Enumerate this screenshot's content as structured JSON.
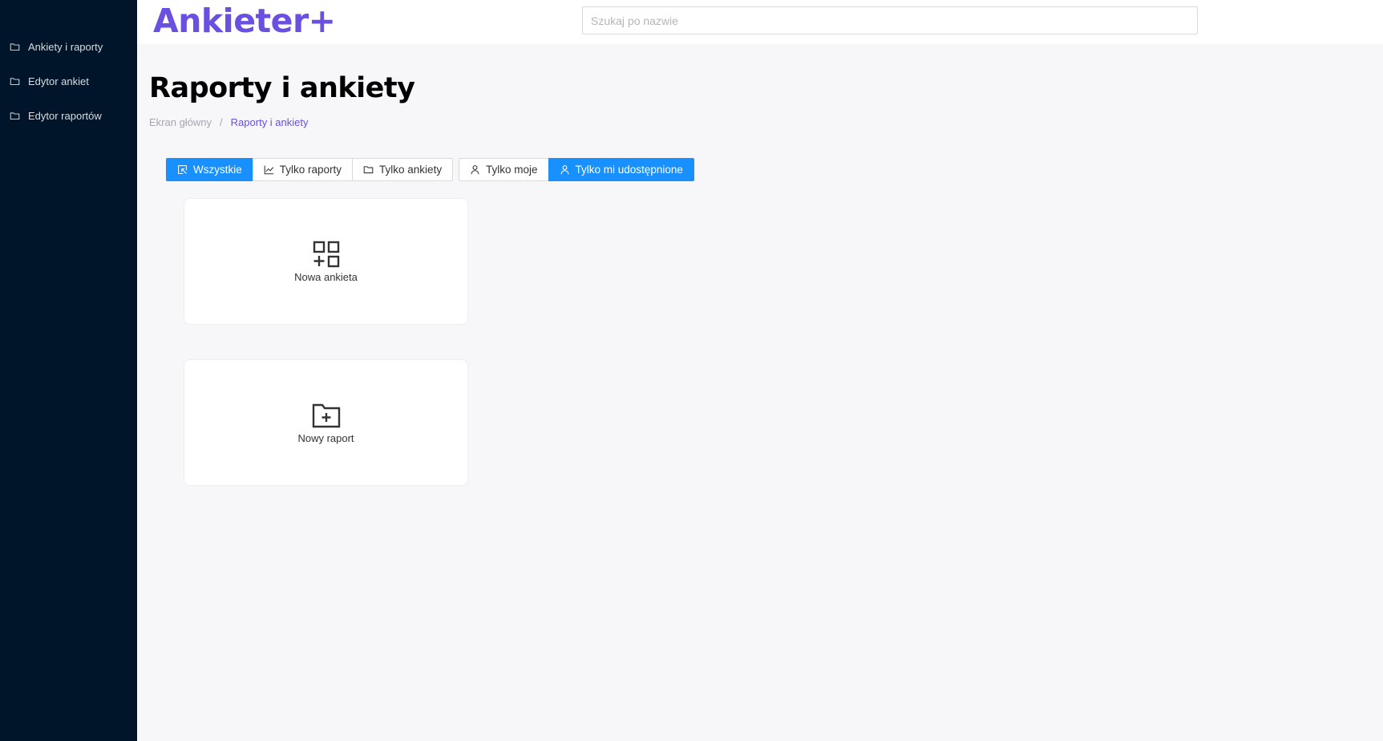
{
  "app": {
    "logo": "Ankieter+"
  },
  "sidebar": {
    "items": [
      {
        "label": "Ankiety i raporty",
        "icon": "folder-icon"
      },
      {
        "label": "Edytor ankiet",
        "icon": "folder-icon"
      },
      {
        "label": "Edytor raportów",
        "icon": "folder-icon"
      }
    ]
  },
  "search": {
    "placeholder": "Szukaj po nazwie",
    "value": ""
  },
  "page": {
    "title": "Raporty i ankiety"
  },
  "breadcrumb": {
    "home": "Ekran główny",
    "separator": "/",
    "current": "Raporty i ankiety"
  },
  "filters": {
    "type": [
      {
        "label": "Wszystkie",
        "icon": "select-icon",
        "active": true
      },
      {
        "label": "Tylko raporty",
        "icon": "line-chart-icon",
        "active": false
      },
      {
        "label": "Tylko ankiety",
        "icon": "folder-icon",
        "active": false
      }
    ],
    "owner": [
      {
        "label": "Tylko moje",
        "icon": "user-icon",
        "active": false
      },
      {
        "label": "Tylko mi udostępnione",
        "icon": "user-icon",
        "active": true
      }
    ]
  },
  "cards": [
    {
      "label": "Nowa ankieta",
      "icon": "add-grid-icon"
    },
    {
      "label": "Nowy raport",
      "icon": "folder-add-icon"
    }
  ],
  "colors": {
    "sidebar_bg": "#001529",
    "accent": "#6a4fe0",
    "active_button": "#1890ff",
    "page_bg": "#f7f7f9"
  }
}
